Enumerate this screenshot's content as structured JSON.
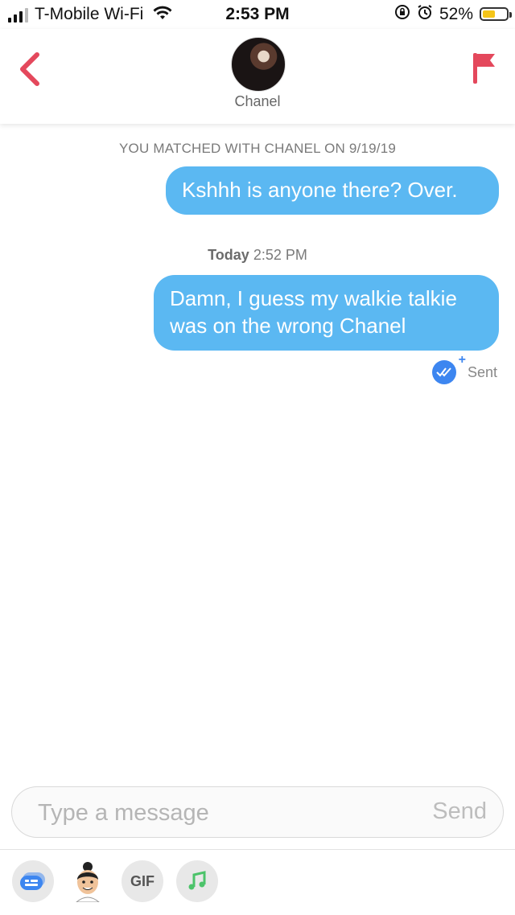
{
  "status_bar": {
    "carrier": "T-Mobile Wi-Fi",
    "time": "2:53 PM",
    "battery_percent": "52%",
    "battery_level": 0.52
  },
  "header": {
    "contact_name": "Chanel"
  },
  "conversation": {
    "matched_text": "YOU MATCHED WITH CHANEL ON 9/19/19",
    "messages": [
      {
        "text": "Kshhh is anyone there? Over.",
        "from": "me"
      },
      {
        "text": "Damn, I guess my walkie talkie was on the wrong Chanel",
        "from": "me"
      }
    ],
    "timestamp_day": "Today",
    "timestamp_time": "2:52 PM",
    "status": "Sent"
  },
  "composer": {
    "placeholder": "Type a message",
    "send_label": "Send"
  },
  "toolbar": {
    "gif_label": "GIF"
  },
  "colors": {
    "bubble": "#5bb8f2",
    "accent_red": "#e4485c",
    "check_blue": "#3d86f0",
    "music_green": "#4cc36a"
  }
}
